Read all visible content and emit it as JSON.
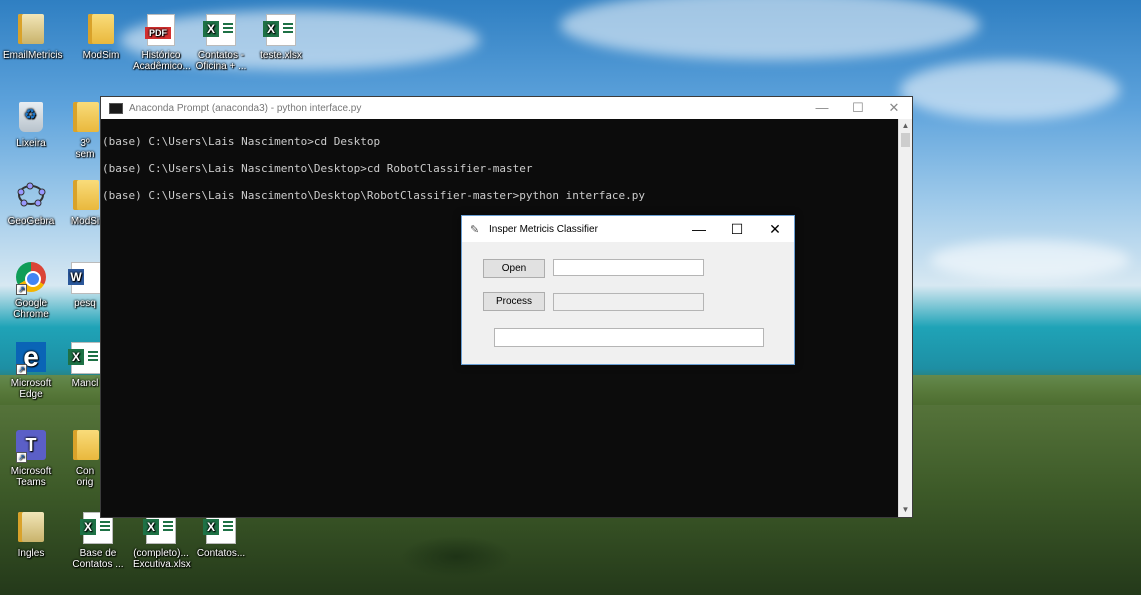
{
  "desktop_icons": [
    {
      "label": "EmailMetricis",
      "type": "app"
    },
    {
      "label": "ModSim",
      "type": "folder"
    },
    {
      "label": "Histórico Acadêmico...",
      "type": "pdf"
    },
    {
      "label": "Contatos - Oficina + ...",
      "type": "excel"
    },
    {
      "label": "teste.xlsx",
      "type": "excel"
    },
    {
      "label": "Lixeira",
      "type": "recycle"
    },
    {
      "label": "3º sem",
      "type": "folder"
    },
    {
      "label": "GeoGebra",
      "type": "app"
    },
    {
      "label": "ModSi",
      "type": "folder"
    },
    {
      "label": "Google Chrome",
      "type": "chrome"
    },
    {
      "label": "pesq",
      "type": "word"
    },
    {
      "label": "Microsoft Edge",
      "type": "edge"
    },
    {
      "label": "Mancl",
      "type": "excel"
    },
    {
      "label": "Microsoft Teams",
      "type": "teams"
    },
    {
      "label": "Con orig",
      "type": "folder"
    },
    {
      "label": "Ingles",
      "type": "app"
    },
    {
      "label": "Base de Contatos ...",
      "type": "excel"
    },
    {
      "label": "(completo)... Excutiva.xlsx",
      "type": "excel"
    },
    {
      "label": "Contatos...",
      "type": "excel"
    }
  ],
  "terminal": {
    "title": "Anaconda Prompt (anaconda3) - python  interface.py",
    "lines": [
      "(base) C:\\Users\\Lais Nascimento>cd Desktop",
      "(base) C:\\Users\\Lais Nascimento\\Desktop>cd RobotClassifier-master",
      "(base) C:\\Users\\Lais Nascimento\\Desktop\\RobotClassifier-master>python interface.py"
    ]
  },
  "dialog": {
    "title": "Insper Metricis Classifier",
    "open_label": "Open",
    "process_label": "Process",
    "path_value": "",
    "process_value": "",
    "status_value": ""
  },
  "window_controls": {
    "minimize": "—",
    "maximize": "☐",
    "close": "✕"
  }
}
